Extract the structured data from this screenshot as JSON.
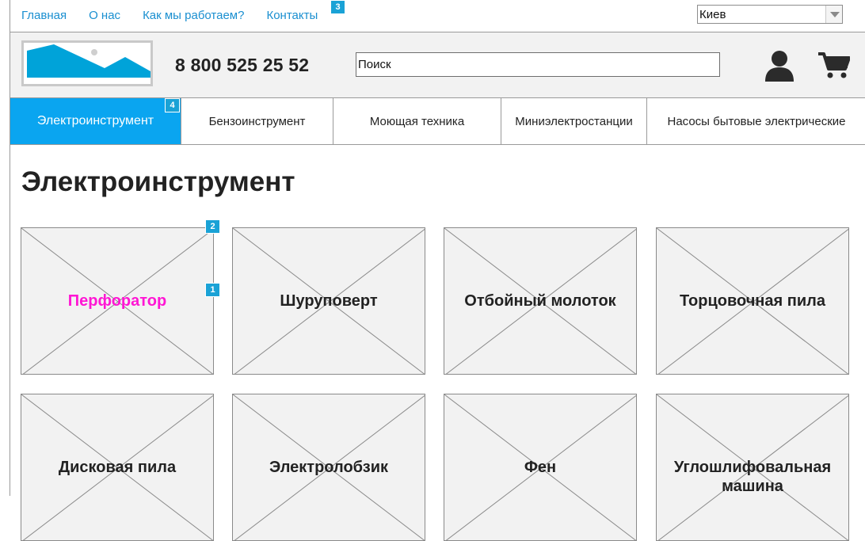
{
  "topnav": {
    "links": [
      "Главная",
      "О нас",
      "Как мы работаем?",
      "Контакты"
    ],
    "city": "Киев"
  },
  "badges": {
    "b1": "1",
    "b2": "2",
    "b3": "3",
    "b4": "4"
  },
  "header": {
    "phone": "8 800 525 25 52",
    "search_value": "Поиск"
  },
  "tabs": [
    "Электроинструмент",
    "Бензоинструмент",
    "Моющая техника",
    "Миниэлектростанции",
    "Насосы бытовые электрические"
  ],
  "page_title": "Электроинструмент",
  "products": [
    {
      "label": "Перфоратор"
    },
    {
      "label": "Шуруповерт"
    },
    {
      "label": "Отбойный молоток"
    },
    {
      "label": "Торцовочная пила"
    },
    {
      "label": "Дисковая пила"
    },
    {
      "label": "Электролобзик"
    },
    {
      "label": "Фен"
    },
    {
      "label": "Углошлифовальная машина"
    }
  ],
  "colors": {
    "accent": "#0aa5f0",
    "link": "#1a8fd0",
    "highlight": "#ff17d4",
    "badge": "#1aa2d6"
  }
}
